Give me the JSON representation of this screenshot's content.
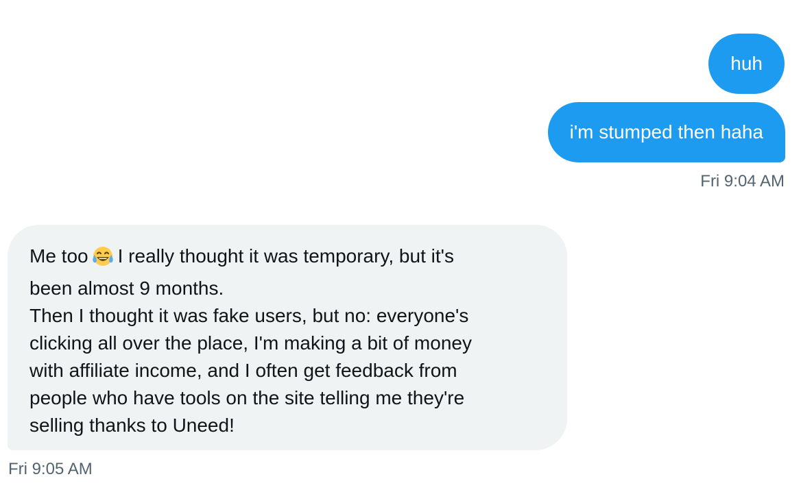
{
  "messages": {
    "sent": [
      {
        "text": "huh"
      },
      {
        "text": "i'm stumped then haha"
      }
    ],
    "sent_timestamp": "Fri 9:04 AM",
    "received": {
      "line1_before_emoji": "Me too",
      "emoji": "face-with-tears-of-joy-icon",
      "line1_after_emoji": "I really thought it was temporary, but it's",
      "lines": [
        "been almost 9 months.",
        "Then I thought it was fake users, but no: everyone's",
        "clicking all over the place, I'm making a bit of money",
        "with affiliate income, and I often get feedback from",
        "people who have tools on the site telling me they're",
        "selling thanks to Uneed!"
      ]
    },
    "received_timestamp": "Fri 9:05 AM"
  },
  "colors": {
    "sent_bubble": "#1d9bf0",
    "received_bubble": "#eff3f4",
    "timestamp": "#536471",
    "text": "#0f1419"
  }
}
